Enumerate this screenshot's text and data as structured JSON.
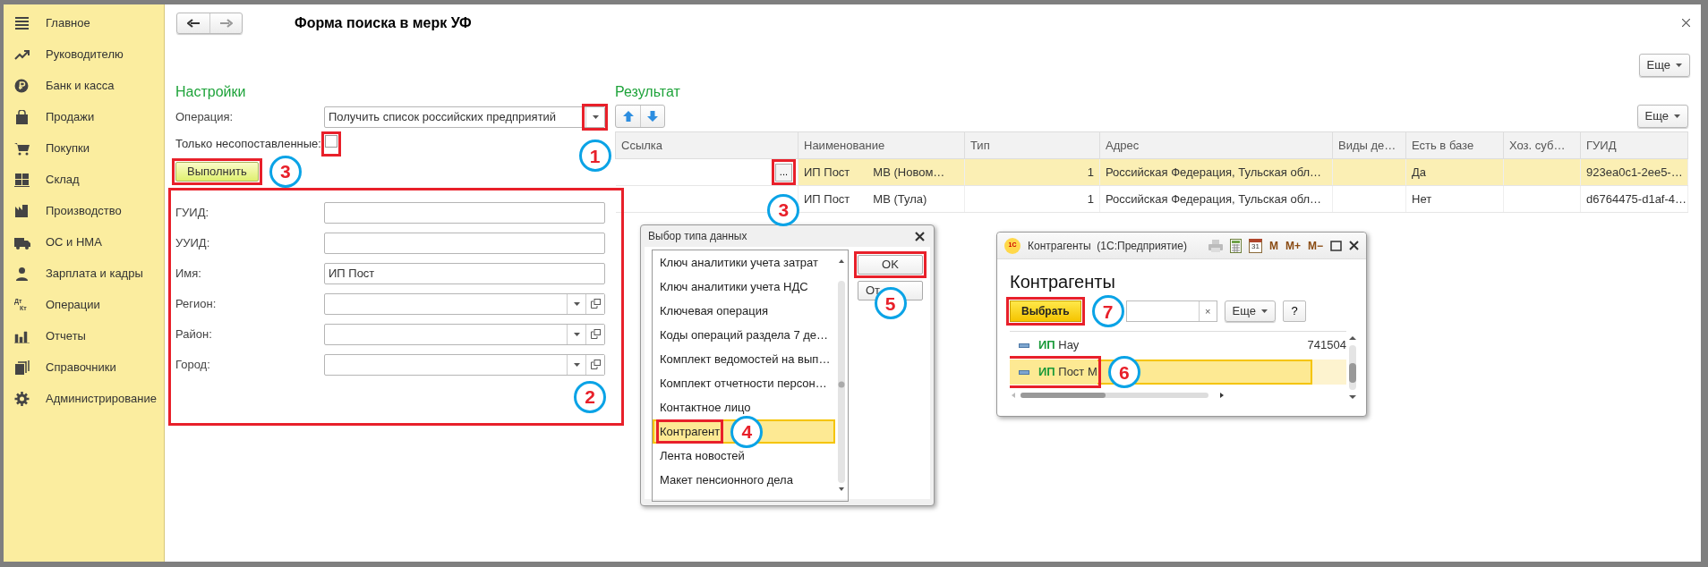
{
  "sidebar": {
    "items": [
      {
        "label": "Главное"
      },
      {
        "label": "Руководителю"
      },
      {
        "label": "Банк и касса"
      },
      {
        "label": "Продажи"
      },
      {
        "label": "Покупки"
      },
      {
        "label": "Склад"
      },
      {
        "label": "Производство"
      },
      {
        "label": "ОС и НМА"
      },
      {
        "label": "Зарплата и кадры"
      },
      {
        "label": "Операции",
        "icon_text": [
          "Дт",
          "Кт"
        ]
      },
      {
        "label": "Отчеты"
      },
      {
        "label": "Справочники"
      },
      {
        "label": "Администрирование"
      }
    ]
  },
  "form": {
    "title": "Форма поиска в мерк УФ",
    "more_button": "Еще"
  },
  "settings": {
    "title": "Настройки",
    "operation": {
      "label": "Операция:",
      "value": "Получить список российских предприятий",
      "annotation": {
        "highlight": true,
        "step": "1"
      }
    },
    "only_unmatched": {
      "label": "Только несопоставленные:",
      "checked": false,
      "annotation": {
        "highlight": true
      }
    },
    "run_button": {
      "label": "Выполнить",
      "annotation": {
        "highlight": true,
        "step": "3"
      }
    },
    "fields": [
      {
        "label": "ГУИД:",
        "kind": "text"
      },
      {
        "label": "УУИД:",
        "kind": "text"
      },
      {
        "label": "Имя:",
        "kind": "text",
        "value": "ИП Пост"
      },
      {
        "label": "Регион:",
        "kind": "select"
      },
      {
        "label": "Район:",
        "kind": "select"
      },
      {
        "label": "Город:",
        "kind": "select"
      }
    ],
    "fields_annotation": {
      "highlight": true,
      "step": "2"
    }
  },
  "result": {
    "title": "Результат",
    "more_button": "Еще",
    "table": {
      "columns": [
        "Ссылка",
        "Наименование",
        "Тип",
        "Адрес",
        "Виды де…",
        "Есть в базе",
        "Хоз. суб…",
        "ГУИД"
      ],
      "rows": [
        {
          "selected": true,
          "link_button": "...",
          "link_annotation": {
            "highlight": true,
            "step": "3"
          },
          "name_parts": [
            "ИП Пост",
            "МВ (Новом…"
          ],
          "type": "1",
          "address": "Российская Федерация, Тульская обл…",
          "in_base": "Да",
          "guid": "923ea0c1-2ee5-…"
        },
        {
          "selected": false,
          "name_parts": [
            "ИП Пост",
            "МВ (Тула)"
          ],
          "type": "1",
          "address": "Российская Федерация, Тульская обл…",
          "in_base": "Нет",
          "guid": "d6764475-d1af-4…"
        }
      ]
    }
  },
  "type_dialog": {
    "title": "Выбор типа данных",
    "items": [
      {
        "label": "Ключ аналитики учета затрат",
        "selected": false
      },
      {
        "label": "Ключ аналитики учета НДС",
        "selected": false
      },
      {
        "label": "Ключевая операция",
        "selected": false
      },
      {
        "label": "Коды операций раздела 7 де…",
        "selected": false
      },
      {
        "label": "Комплект ведомостей на вып…",
        "selected": false
      },
      {
        "label": "Комплект отчетности персон…",
        "selected": false
      },
      {
        "label": "Контактное лицо",
        "selected": false
      },
      {
        "label": "Контрагент",
        "selected": true,
        "annotation": {
          "highlight": true,
          "step": "4"
        }
      },
      {
        "label": "Лента новостей",
        "selected": false
      },
      {
        "label": "Макет пенсионного дела",
        "selected": false
      }
    ],
    "ok_button": {
      "label": "OK",
      "annotation": {
        "highlight": true,
        "step": "5"
      }
    },
    "cancel_button": "От"
  },
  "counterparties_window": {
    "title": "Контрагенты  (1С:Предприятие)",
    "logo": "1С",
    "calendar_day": "31",
    "memory_buttons": [
      "M",
      "M+",
      "M−"
    ],
    "heading": "Контрагенты",
    "select_button": {
      "label": "Выбрать",
      "annotation": {
        "highlight": true,
        "step": "7"
      }
    },
    "clear_button": "×",
    "more_button": "Еще",
    "help_button": "?",
    "rows": [
      {
        "text": "**ИП** Нау",
        "code": "741504",
        "selected": false
      },
      {
        "text": "**ИП** Пост М",
        "selected": true,
        "annotation": {
          "highlight": true,
          "step": "6"
        }
      }
    ]
  }
}
